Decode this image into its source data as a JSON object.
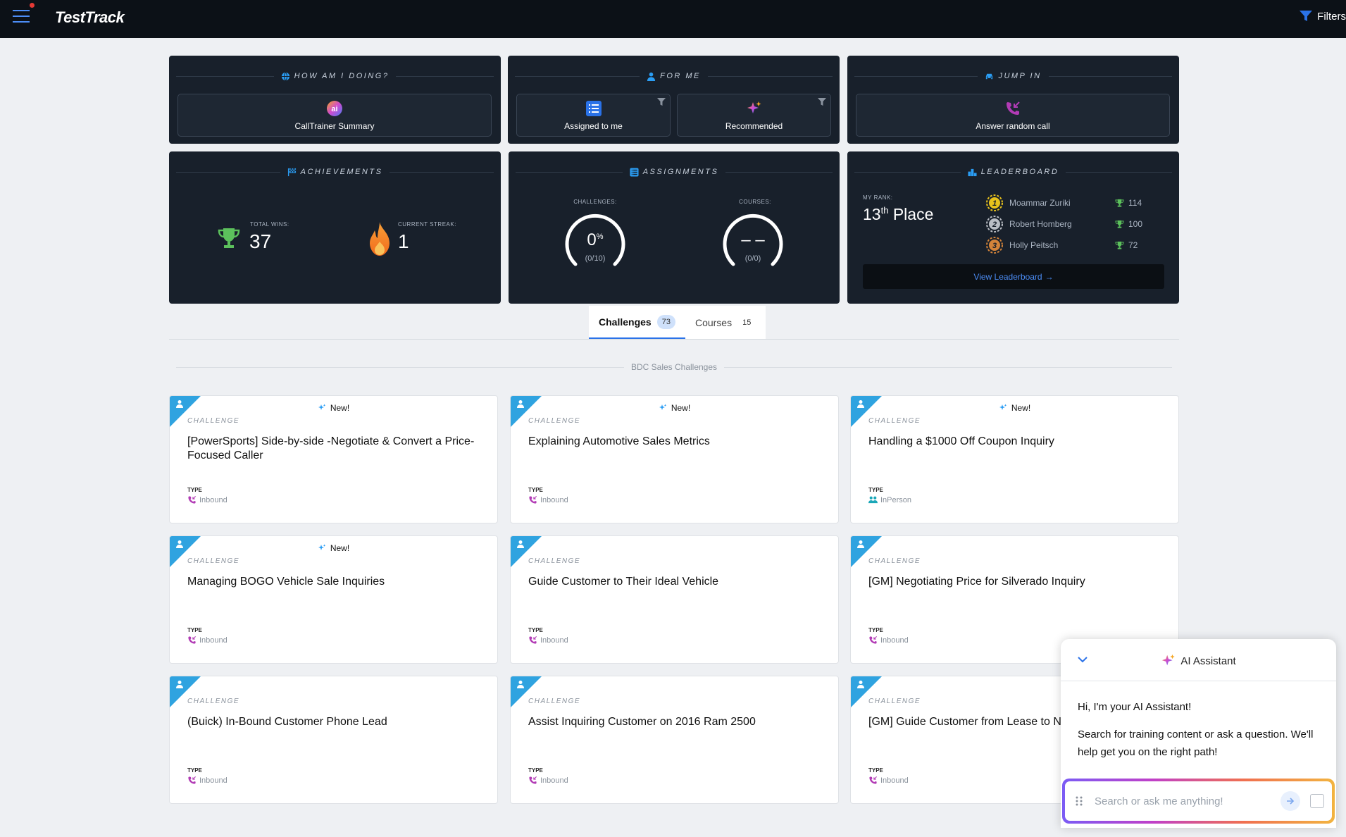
{
  "topbar": {
    "brand": "TestTrack",
    "filters_label": "Filters"
  },
  "panels": {
    "how": {
      "header": "How am I doing?",
      "tile_label": "CallTrainer Summary"
    },
    "forme": {
      "header": "For Me",
      "assigned_label": "Assigned to me",
      "recommended_label": "Recommended"
    },
    "jump": {
      "header": "Jump In",
      "tile_label": "Answer random call"
    },
    "achievements": {
      "header": "Achievements",
      "total_wins_label": "Total wins:",
      "total_wins": "37",
      "streak_label": "Current streak:",
      "streak": "1"
    },
    "assignments": {
      "header": "Assignments",
      "challenges_label": "Challenges:",
      "challenges_value": "0",
      "challenges_unit": "%",
      "challenges_sub": "(0/10)",
      "courses_label": "Courses:",
      "courses_value": "– –",
      "courses_sub": "(0/0)",
      "challenges_progress": 0,
      "courses_progress": 0
    },
    "leaderboard": {
      "header": "Leaderboard",
      "my_rank_label": "My rank:",
      "rank_num": "13",
      "rank_suffix": "th",
      "rank_word": " Place",
      "entries": [
        {
          "rank": "1",
          "name": "Moammar Zuriki",
          "score": "114",
          "medal_color": "#e8c21c"
        },
        {
          "rank": "2",
          "name": "Robert Homberg",
          "score": "100",
          "medal_color": "#b9bdc4"
        },
        {
          "rank": "3",
          "name": "Holly Peitsch",
          "score": "72",
          "medal_color": "#d2833a"
        }
      ],
      "view_label": "View Leaderboard"
    }
  },
  "tabs": [
    {
      "label": "Challenges",
      "count": "73"
    },
    {
      "label": "Courses",
      "count": "15"
    }
  ],
  "section_title": "BDC Sales Challenges",
  "new_label": "New!",
  "kind_label": "CHALLENGE",
  "type_label": "TYPE",
  "cards": [
    {
      "title": "[PowerSports] Side-by-side -Negotiate & Convert a Price-Focused Caller",
      "type": "Inbound"
    },
    {
      "title": "Explaining Automotive Sales Metrics",
      "type": "Inbound"
    },
    {
      "title": "Handling a $1000 Off Coupon Inquiry",
      "type": "InPerson"
    },
    {
      "title": "Managing BOGO Vehicle Sale Inquiries",
      "type": "Inbound"
    },
    {
      "title": "Guide Customer to Their Ideal Vehicle",
      "type": "Inbound"
    },
    {
      "title": "[GM] Negotiating Price for Silverado Inquiry",
      "type": "Inbound"
    },
    {
      "title": "(Buick) In-Bound Customer Phone Lead",
      "type": "Inbound"
    },
    {
      "title": "Assist Inquiring Customer on 2016 Ram 2500",
      "type": "Inbound"
    },
    {
      "title": "[GM] Guide Customer from Lease to Ne",
      "type": "Inbound"
    }
  ],
  "ai": {
    "title": "AI Assistant",
    "greeting": "Hi, I'm your AI Assistant!",
    "intro": "Search for training content or ask a question. We'll help get you on the right path!",
    "placeholder": "Search or ask me anything!"
  },
  "colors": {
    "accent": "#2a72e8",
    "ribbon": "#2fa3e0",
    "panel": "#18202b",
    "inbound_icon": "#b23bb5",
    "inperson_icon": "#1aa7b8"
  }
}
